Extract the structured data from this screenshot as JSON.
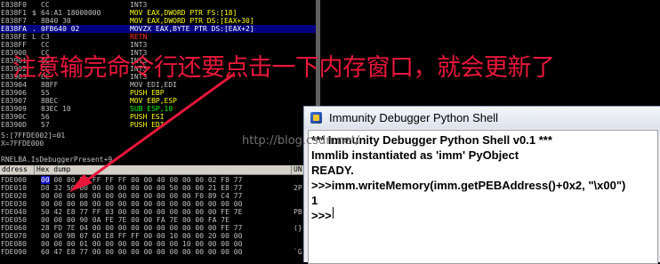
{
  "disassembly": {
    "rows": [
      {
        "addr": "E838F0",
        "mark": "",
        "hex": "CC",
        "inst": "INT3",
        "color": ""
      },
      {
        "addr": "E838F1",
        "mark": "$",
        "hex": "64:A1 18000000",
        "inst": "MOV EAX,DWORD PTR FS:[18]",
        "color": "yellow"
      },
      {
        "addr": "E838F7",
        "mark": ".",
        "hex": "8B40 30",
        "inst": "MOV EAX,DWORD PTR DS:[EAX+30]",
        "color": "yellow"
      },
      {
        "addr": "E838FA",
        "mark": ".",
        "hex": "0FB640 02",
        "inst": "MOVZX EAX,BYTE PTR DS:[EAX+2]",
        "color": "selected"
      },
      {
        "addr": "E838FE",
        "mark": "L",
        "hex": "C3",
        "inst": "RETN",
        "color": "red"
      },
      {
        "addr": "E838FF",
        "mark": "",
        "hex": "CC",
        "inst": "INT3",
        "color": ""
      },
      {
        "addr": "E83900",
        "mark": "",
        "hex": "CC",
        "inst": "INT3",
        "color": ""
      },
      {
        "addr": "E83901",
        "mark": "",
        "hex": "CC",
        "inst": "INT3",
        "color": ""
      },
      {
        "addr": "E83902",
        "mark": "",
        "hex": "CC",
        "inst": "INT3",
        "color": ""
      },
      {
        "addr": "E83903",
        "mark": "",
        "hex": "CC",
        "inst": "INT3",
        "color": ""
      },
      {
        "addr": "E83904",
        "mark": "",
        "hex": "8BFF",
        "inst": "MOV EDI,EDI",
        "color": ""
      },
      {
        "addr": "E83906",
        "mark": "",
        "hex": "55",
        "inst": "PUSH EBP",
        "color": "yellow"
      },
      {
        "addr": "E83907",
        "mark": "",
        "hex": "8BEC",
        "inst": "MOV EBP,ESP",
        "color": "yellow"
      },
      {
        "addr": "E83909",
        "mark": "",
        "hex": "83EC 10",
        "inst": "SUB ESP,10",
        "color": "green"
      },
      {
        "addr": "E8390C",
        "mark": "",
        "hex": "56",
        "inst": "PUSH ESI",
        "color": "yellow"
      },
      {
        "addr": "E8390D",
        "mark": "",
        "hex": "57",
        "inst": "PUSH EDI",
        "color": "yellow"
      }
    ]
  },
  "info": {
    "lines": [
      "S:[7FFDE002]=01",
      "X=7FFDE000",
      "",
      "RNELBA.IsDebuggerPresent+9"
    ]
  },
  "dump": {
    "headers": [
      "ddress",
      "Hex dump",
      "UN"
    ],
    "rows": [
      {
        "addr": "FDE000",
        "first": "00",
        "rest": " 00 00 FF FF FF FF 00 00 40 00 00 00 02 F8 77",
        "asc": "  "
      },
      {
        "addr": "FDE010",
        "first": "D8",
        "rest": " 32 50 00 00 00 00 00 00 00 50 00 00 21 E8 77",
        "asc": "2P"
      },
      {
        "addr": "FDE020",
        "first": "00",
        "rest": " 00 00 00 00 00 00 00 00 00 00 00 F0 89 C4 77",
        "asc": "  "
      },
      {
        "addr": "FDE030",
        "first": "00",
        "rest": " 00 00 00 00 00 00 00 00 00 00 00 00 00 00 00",
        "asc": "  "
      },
      {
        "addr": "FDE040",
        "first": "50",
        "rest": " 42 E8 77 FF 03 00 00 00 00 00 00 00 00 FE 7E",
        "asc": "PB"
      },
      {
        "addr": "FDE050",
        "first": "00",
        "rest": " 00 00 90 0A FE 7E 00 00 FA 7E 00 00 FA 7E",
        "asc": "  "
      },
      {
        "addr": "FDE060",
        "first": "28",
        "rest": " FD 7E 04 00 00 00 00 00 00 00 00 00 00 FE 77",
        "asc": "(}"
      },
      {
        "addr": "FDE070",
        "first": "00",
        "rest": " 00 9B 07 6D E8 FF FF 00 00 10 00 00 20 00 00",
        "asc": "  "
      },
      {
        "addr": "FDE080",
        "first": "00",
        "rest": " 00 00 01 00 00 00 00 00 00 00 10 00 00 00 00",
        "asc": "  "
      },
      {
        "addr": "FDE090",
        "first": "60",
        "rest": " 47 E8 77 00 00 00 00 00 00 00 00 00 00 00 00",
        "asc": "`G"
      }
    ]
  },
  "annotation": {
    "text": "注意输完命令行还要点击一下内存窗口，就会更新了",
    "color": "#e8173a"
  },
  "watermark": "http://blog.csdn.net/",
  "shell": {
    "title": "Immunity Debugger Python Shell",
    "lines": [
      "*** Immunity Debugger Python Shell v0.1 ***",
      "Immlib instantiated as 'imm' PyObject",
      "READY.",
      ">>>imm.writeMemory(imm.getPEBAddress()+0x2, \"\\x00\")",
      "1",
      ">>>"
    ]
  }
}
